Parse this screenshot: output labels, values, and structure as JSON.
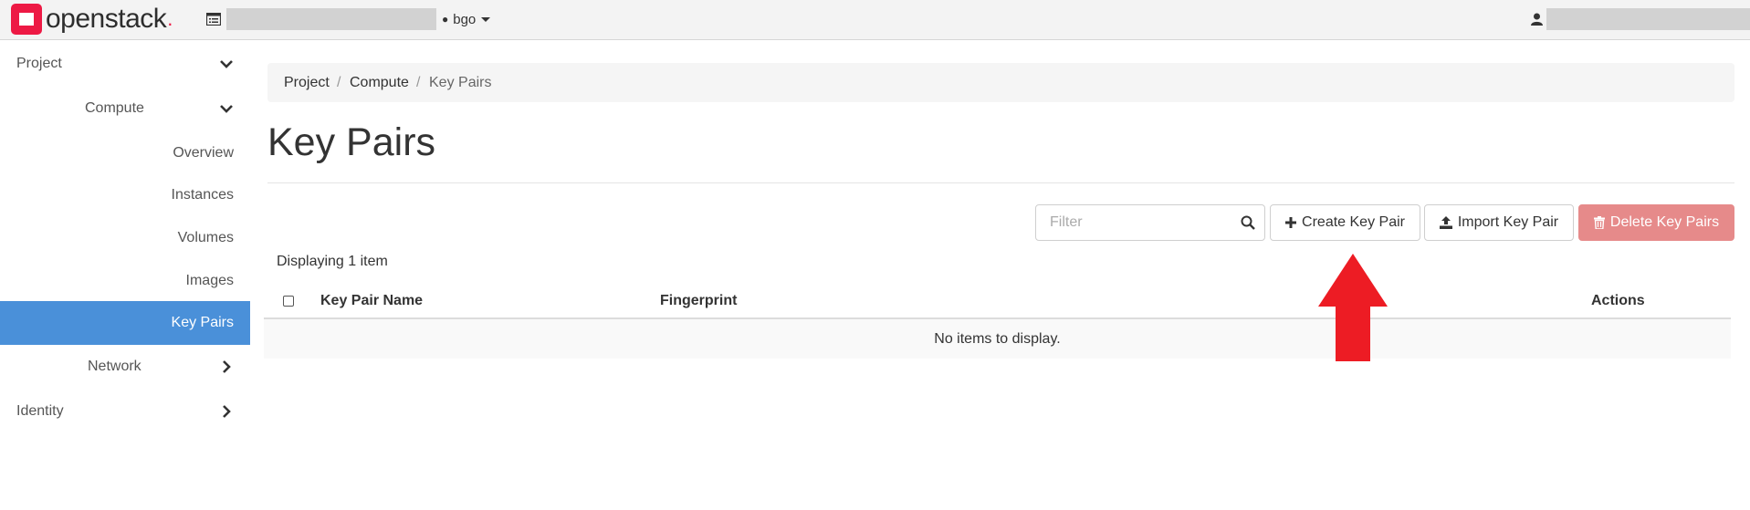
{
  "colors": {
    "brand_red": "#ed1944",
    "active_nav": "#4a90d9",
    "danger_button": "#e68a8a",
    "annotation_arrow": "#ed1c24"
  },
  "header": {
    "logo_text": "openstack",
    "logo_dot": ".",
    "project_name": "bgo",
    "project_icon": "project-list-icon",
    "user_icon": "user-icon"
  },
  "sidebar": {
    "items": [
      {
        "label": "Project",
        "icon": "chevron-down-icon"
      },
      {
        "label": "Compute",
        "icon": "chevron-down-icon"
      },
      {
        "label": "Overview"
      },
      {
        "label": "Instances"
      },
      {
        "label": "Volumes"
      },
      {
        "label": "Images"
      },
      {
        "label": "Key Pairs",
        "active": true
      },
      {
        "label": "Network",
        "icon": "chevron-right-icon"
      },
      {
        "label": "Identity",
        "icon": "chevron-right-icon"
      }
    ]
  },
  "breadcrumb": {
    "items": [
      "Project",
      "Compute",
      "Key Pairs"
    ],
    "separator": "/"
  },
  "page": {
    "title": "Key Pairs"
  },
  "toolbar": {
    "filter_placeholder": "Filter",
    "filter_value": "",
    "create_label": "Create Key Pair",
    "import_label": "Import Key Pair",
    "delete_label": "Delete Key Pairs"
  },
  "table": {
    "count_text": "Displaying 1 item",
    "columns": [
      "Key Pair Name",
      "Fingerprint",
      "Actions"
    ],
    "empty_text": "No items to display."
  }
}
